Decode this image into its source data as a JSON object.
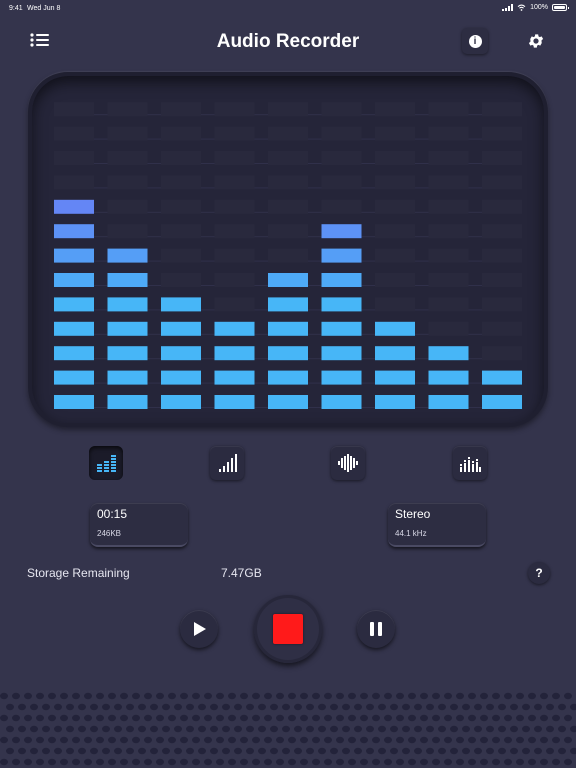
{
  "status_bar": {
    "time": "9:41",
    "date": "Wed Jun 8",
    "battery": "100%"
  },
  "header": {
    "title": "Audio Recorder"
  },
  "visualizer": {
    "levels": [
      9,
      7,
      5,
      4,
      6,
      8,
      4,
      3,
      2
    ],
    "max_level": 13,
    "low_color": "#47b6f7",
    "high_color": "#6b7af5"
  },
  "modes": [
    "bars-equalizer",
    "signal-ramp",
    "waveform",
    "spectrum-dots"
  ],
  "recording": {
    "duration": "00:15",
    "size": "246KB"
  },
  "audio_format": {
    "channels": "Stereo",
    "sample_rate": "44.1 kHz"
  },
  "storage": {
    "label": "Storage Remaining",
    "value": "7.47GB"
  },
  "help_label": "?",
  "colors": {
    "background": "#34344c",
    "record": "#ff1a1a",
    "accent": "#47b6f7"
  }
}
